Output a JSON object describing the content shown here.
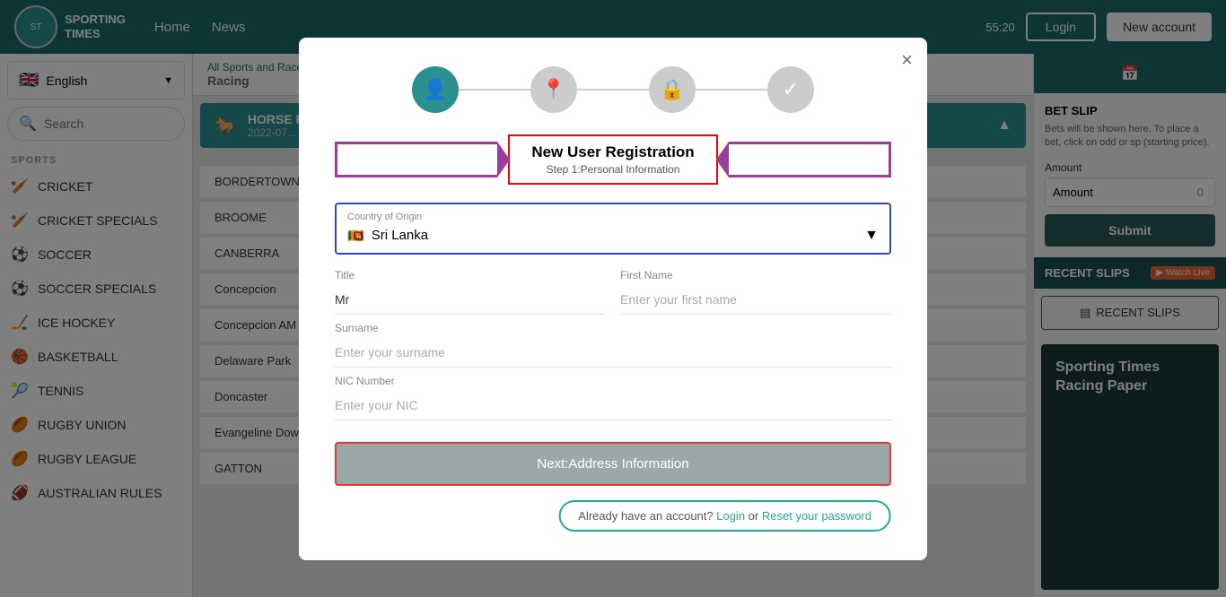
{
  "header": {
    "logo_text_line1": "SPORTING",
    "logo_text_line2": "TIMES",
    "nav": [
      {
        "label": "Home",
        "id": "home"
      },
      {
        "label": "News",
        "id": "news"
      }
    ],
    "time": "55:20",
    "btn_login": "Login",
    "btn_new_account": "New account"
  },
  "sidebar": {
    "language": "English",
    "search_placeholder": "Search",
    "sports_label": "SPORTS",
    "sports": [
      {
        "icon": "🏏",
        "label": "CRICKET"
      },
      {
        "icon": "🏏",
        "label": "CRICKET SPECIALS"
      },
      {
        "icon": "⚽",
        "label": "SOCCER"
      },
      {
        "icon": "⚽",
        "label": "SOCCER SPECIALS"
      },
      {
        "icon": "🏒",
        "label": "ICE HOCKEY"
      },
      {
        "icon": "🏀",
        "label": "BASKETBALL"
      },
      {
        "icon": "🎾",
        "label": "TENNIS"
      },
      {
        "icon": "🏉",
        "label": "RUGBY UNION"
      },
      {
        "icon": "🏉",
        "label": "RUGBY LEAGUE"
      },
      {
        "icon": "🏈",
        "label": "AUSTRALIAN RULES"
      }
    ]
  },
  "breadcrumb": {
    "all_sports": "All Sports and Races",
    "sub": "Racing"
  },
  "race_banner": {
    "title": "HORSE RA...",
    "date": "2022-07..."
  },
  "locations": [
    "BORDERTOWN",
    "BROOME",
    "CANBERRA",
    "Concepcion",
    "Concepcion AM",
    "Delaware Park",
    "Doncaster",
    "Evangeline Downs",
    "GATTON"
  ],
  "right_panel": {
    "bet_slip_title": "BET SLIP",
    "bet_slip_text": "Bets will be shown here. To place a bet, click on odd or sp (starting price).",
    "amount_label": "Amount",
    "amount_value": "0",
    "btn_submit": "Submit",
    "recent_slips_label": "RECENT SLIPS",
    "watch_live_label": "Watch Live",
    "btn_recent_slips": "RECENT SLIPS",
    "racing_paper_title": "Sporting Times Racing Paper"
  },
  "modal": {
    "close_label": "×",
    "steps": [
      {
        "icon": "👤",
        "active": true
      },
      {
        "icon": "📍",
        "active": false
      },
      {
        "icon": "🔒",
        "active": false
      },
      {
        "icon": "✓",
        "active": false
      }
    ],
    "title": "New User Registration",
    "subtitle": "Step 1:Personal Information",
    "country_label": "Country of Origin",
    "country_value": "Sri Lanka",
    "country_flag": "🇱🇰",
    "title_label": "Title",
    "title_value": "Mr",
    "first_name_label": "First Name",
    "first_name_placeholder": "Enter your first name",
    "surname_label": "Surname",
    "surname_placeholder": "Enter your surname",
    "nic_label": "NIC Number",
    "nic_placeholder": "Enter your NIC",
    "btn_next": "Next:Address Information",
    "already_text": "Already have an account?",
    "login_link": "Login",
    "or_text": "or",
    "reset_link": "Reset your password"
  }
}
